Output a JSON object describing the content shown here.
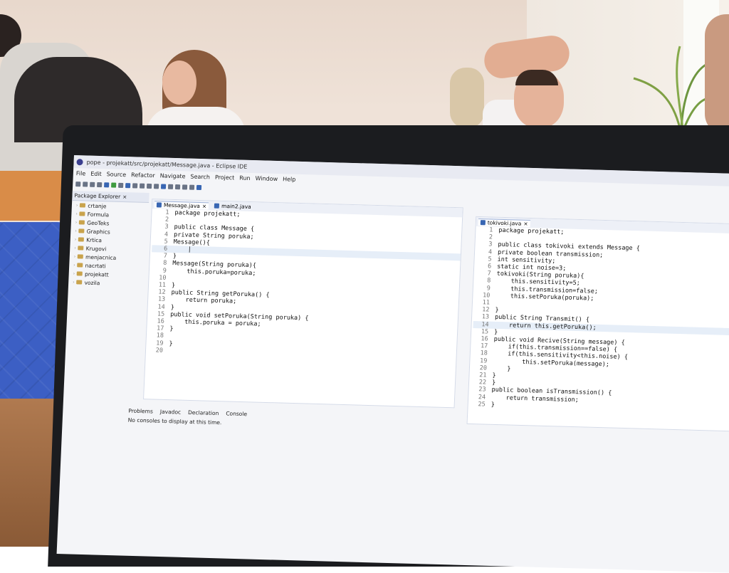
{
  "window": {
    "title": "pope - projekatt/src/projekatt/Message.java - Eclipse IDE"
  },
  "menu": [
    "File",
    "Edit",
    "Source",
    "Refactor",
    "Navigate",
    "Search",
    "Project",
    "Run",
    "Window",
    "Help"
  ],
  "package_explorer": {
    "title": "Package Explorer",
    "projects": [
      "crtanje",
      "Formula",
      "GeoTeks",
      "Graphics",
      "Krtica",
      "Krugovi",
      "menjacnica",
      "nacrtati",
      "projekatt",
      "vozila"
    ]
  },
  "left_editor": {
    "tabs": [
      "Message.java",
      "main2.java"
    ],
    "lines": [
      {
        "n": "1",
        "text": "package projekatt;"
      },
      {
        "n": "2",
        "text": ""
      },
      {
        "n": "3",
        "text": "public class Message {"
      },
      {
        "n": "4",
        "text": "private String poruka;"
      },
      {
        "n": "5",
        "text": "Message(){"
      },
      {
        "n": "6",
        "text": "    |"
      },
      {
        "n": "7",
        "text": "}"
      },
      {
        "n": "8",
        "text": "Message(String poruka){"
      },
      {
        "n": "9",
        "text": "    this.poruka=poruka;"
      },
      {
        "n": "10",
        "text": ""
      },
      {
        "n": "11",
        "text": "}"
      },
      {
        "n": "12",
        "text": "public String getPoruka() {"
      },
      {
        "n": "13",
        "text": "    return poruka;"
      },
      {
        "n": "14",
        "text": "}"
      },
      {
        "n": "15",
        "text": "public void setPoruka(String poruka) {"
      },
      {
        "n": "16",
        "text": "    this.poruka = poruka;"
      },
      {
        "n": "17",
        "text": "}"
      },
      {
        "n": "18",
        "text": ""
      },
      {
        "n": "19",
        "text": "}"
      },
      {
        "n": "20",
        "text": ""
      }
    ]
  },
  "right_editor": {
    "tabs": [
      "tokivoki.java"
    ],
    "lines": [
      {
        "n": "1",
        "text": "package projekatt;"
      },
      {
        "n": "2",
        "text": ""
      },
      {
        "n": "3",
        "text": "public class tokivoki extends Message {"
      },
      {
        "n": "4",
        "text": "private boolean transmission;"
      },
      {
        "n": "5",
        "text": "int sensitivity;"
      },
      {
        "n": "6",
        "text": "static int noise=3;"
      },
      {
        "n": "7",
        "text": "tokivoki(String poruka){"
      },
      {
        "n": "8",
        "text": "    this.sensitivity=5;"
      },
      {
        "n": "9",
        "text": "    this.transmission=false;"
      },
      {
        "n": "10",
        "text": "    this.setPoruka(poruka);"
      },
      {
        "n": "11",
        "text": ""
      },
      {
        "n": "12",
        "text": "}"
      },
      {
        "n": "13",
        "text": "public String Transmit() {"
      },
      {
        "n": "14",
        "text": "    return this.getPoruka();"
      },
      {
        "n": "15",
        "text": "}"
      },
      {
        "n": "16",
        "text": "public void Recive(String message) {"
      },
      {
        "n": "17",
        "text": "    if(this.transmission==false) {"
      },
      {
        "n": "18",
        "text": "    if(this.sensitivity<this.noise) {"
      },
      {
        "n": "19",
        "text": "        this.setPoruka(message);"
      },
      {
        "n": "20",
        "text": "    }"
      },
      {
        "n": "21",
        "text": "}"
      },
      {
        "n": "22",
        "text": "}"
      },
      {
        "n": "23",
        "text": "public boolean isTransmission() {"
      },
      {
        "n": "24",
        "text": "    return transmission;"
      },
      {
        "n": "25",
        "text": "}"
      }
    ]
  },
  "console": {
    "tabs": [
      "Problems",
      "Javadoc",
      "Declaration",
      "Console"
    ],
    "message": "No consoles to display at this time."
  }
}
